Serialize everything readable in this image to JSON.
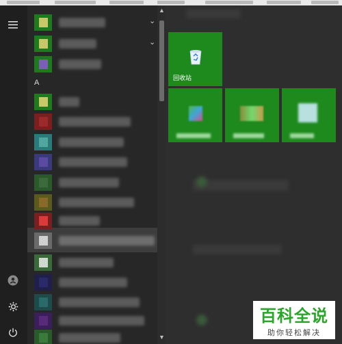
{
  "app_list": {
    "section_letter": "A",
    "rows_before_section": [
      {
        "icon_color": "#c8c86a",
        "has_chevron": true
      },
      {
        "icon_color": "#c8c86a",
        "has_chevron": true
      },
      {
        "icon_color": "#7a5fb4",
        "has_chevron": false
      }
    ],
    "rows_after_section": [
      {
        "icon_color": "#c8c86a"
      },
      {
        "icon_color": "#9b2b2b"
      },
      {
        "icon_color": "#4fa7a0"
      },
      {
        "icon_color": "#5a4aa0"
      },
      {
        "icon_color": "#3d6a3d"
      },
      {
        "icon_color": "#8a6a2a"
      },
      {
        "icon_color": "#d93a3a"
      },
      {
        "icon_color": "#d0d0d0",
        "highlighted": true
      },
      {
        "icon_color": "#cfd9cf"
      },
      {
        "icon_color": "#2a2a6a"
      },
      {
        "icon_color": "#2a6a6a"
      },
      {
        "icon_color": "#5a2a7a"
      },
      {
        "icon_color": "#3a7a3a"
      }
    ]
  },
  "rail": {
    "menu_icon": "hamburger-icon",
    "user_icon": "user-icon",
    "settings_icon": "gear-icon",
    "power_icon": "power-icon"
  },
  "tiles": [
    {
      "label": "回收站",
      "icon": "recycle-bin-icon"
    },
    {
      "label": "",
      "icon": "blurred-app-icon"
    },
    {
      "label": "",
      "icon": "blurred-app-icon"
    },
    {
      "label": "",
      "icon": "blurred-app-icon"
    }
  ],
  "watermark": {
    "title": "百科全说",
    "subtitle": "助你轻松解决"
  },
  "colors": {
    "tile_green": "#1e8a1e",
    "rail_bg": "#1f1f1f",
    "list_bg": "#272727"
  }
}
